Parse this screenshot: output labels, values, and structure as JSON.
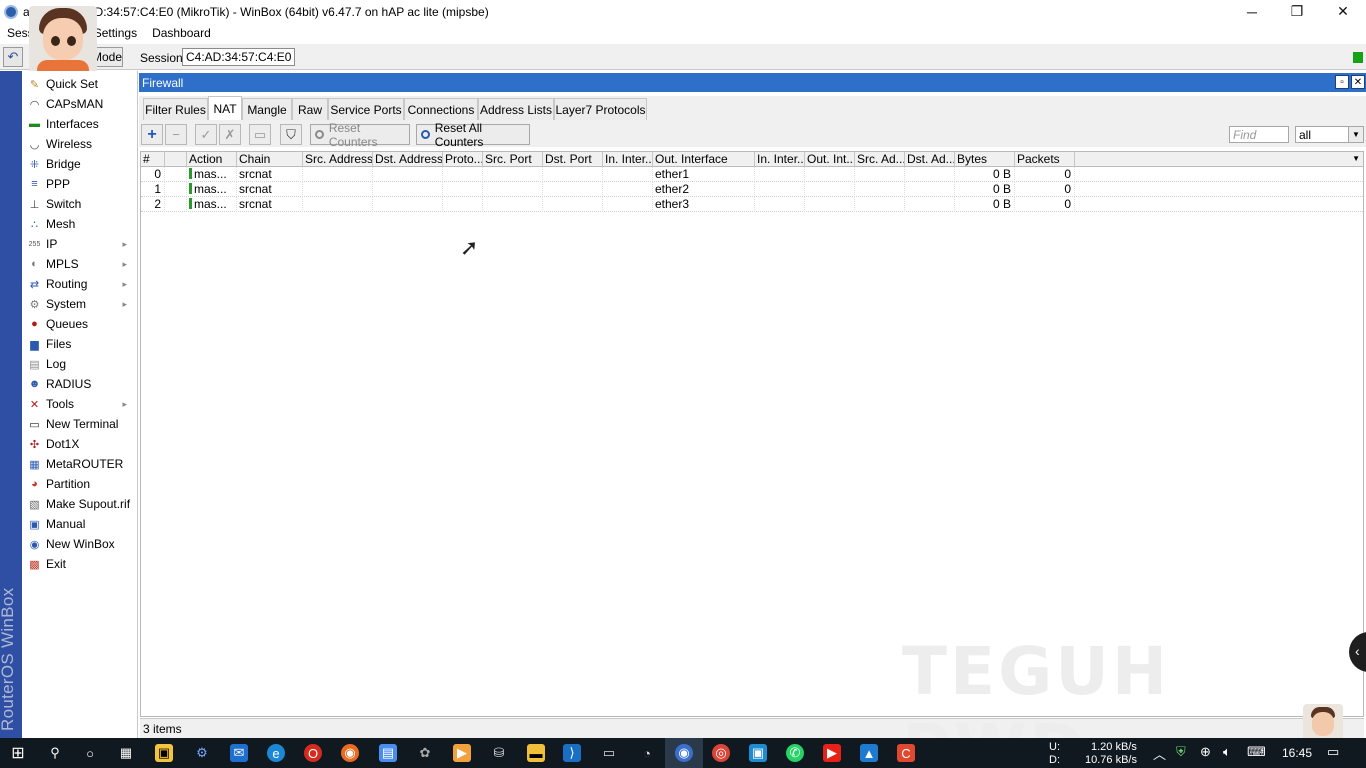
{
  "window": {
    "title": "admin@C4:AD:34:57:C4:E0 (MikroTik) - WinBox (64bit) v6.47.7 on hAP ac lite (mipsbe)",
    "minimize": "─",
    "restore": "❐",
    "close": "✕"
  },
  "menubar": {
    "items": [
      "Session",
      "Settings",
      "Dashboard"
    ]
  },
  "toolbar": {
    "undo": "↶",
    "safe_mode": "Safe Mode",
    "session_label": "Session:",
    "session_value": "C4:AD:34:57:C4:E0"
  },
  "brand": "RouterOS WinBox",
  "sidebar": {
    "items": [
      {
        "label": "Quick Set",
        "icon": "quick-set-icon",
        "glyph": "✎",
        "color": "#b58b2a",
        "submenu": false
      },
      {
        "label": "CAPsMAN",
        "icon": "capsman-icon",
        "glyph": "◠",
        "color": "#444",
        "submenu": false
      },
      {
        "label": "Interfaces",
        "icon": "interfaces-icon",
        "glyph": "▬",
        "color": "#1c8a1c",
        "submenu": false
      },
      {
        "label": "Wireless",
        "icon": "wireless-icon",
        "glyph": "◡",
        "color": "#444",
        "submenu": false
      },
      {
        "label": "Bridge",
        "icon": "bridge-icon",
        "glyph": "⁜",
        "color": "#2a59b0",
        "submenu": false
      },
      {
        "label": "PPP",
        "icon": "ppp-icon",
        "glyph": "≡",
        "color": "#2a59b0",
        "submenu": false
      },
      {
        "label": "Switch",
        "icon": "switch-icon",
        "glyph": "⊥",
        "color": "#444",
        "submenu": false
      },
      {
        "label": "Mesh",
        "icon": "mesh-icon",
        "glyph": "∴",
        "color": "#2a59b0",
        "submenu": false
      },
      {
        "label": "IP",
        "icon": "ip-icon",
        "glyph": "255",
        "color": "#555",
        "submenu": true
      },
      {
        "label": "MPLS",
        "icon": "mpls-icon",
        "glyph": "◐",
        "color": "#777",
        "submenu": true
      },
      {
        "label": "Routing",
        "icon": "routing-icon",
        "glyph": "⇄",
        "color": "#2a59b0",
        "submenu": true
      },
      {
        "label": "System",
        "icon": "system-icon",
        "glyph": "⚙",
        "color": "#777",
        "submenu": true
      },
      {
        "label": "Queues",
        "icon": "queues-icon",
        "glyph": "●",
        "color": "#b01c1c",
        "submenu": false
      },
      {
        "label": "Files",
        "icon": "files-icon",
        "glyph": "▆",
        "color": "#2a59b0",
        "submenu": false
      },
      {
        "label": "Log",
        "icon": "log-icon",
        "glyph": "▤",
        "color": "#888",
        "submenu": false
      },
      {
        "label": "RADIUS",
        "icon": "radius-icon",
        "glyph": "☻",
        "color": "#2a59b0",
        "submenu": false
      },
      {
        "label": "Tools",
        "icon": "tools-icon",
        "glyph": "✕",
        "color": "#b01c1c",
        "submenu": true
      },
      {
        "label": "New Terminal",
        "icon": "terminal-icon",
        "glyph": "▭",
        "color": "#222",
        "submenu": false
      },
      {
        "label": "Dot1X",
        "icon": "dot1x-icon",
        "glyph": "✣",
        "color": "#b01c1c",
        "submenu": false
      },
      {
        "label": "MetaROUTER",
        "icon": "metarouter-icon",
        "glyph": "▦",
        "color": "#2a59b0",
        "submenu": false
      },
      {
        "label": "Partition",
        "icon": "partition-icon",
        "glyph": "◕",
        "color": "#c0392b",
        "submenu": false
      },
      {
        "label": "Make Supout.rif",
        "icon": "supout-icon",
        "glyph": "▧",
        "color": "#666",
        "submenu": false
      },
      {
        "label": "Manual",
        "icon": "manual-icon",
        "glyph": "▣",
        "color": "#2a59b0",
        "submenu": false
      },
      {
        "label": "New WinBox",
        "icon": "winbox-icon",
        "glyph": "◉",
        "color": "#2a59b0",
        "submenu": false
      },
      {
        "label": "Exit",
        "icon": "exit-icon",
        "glyph": "▩",
        "color": "#c0392b",
        "submenu": false
      }
    ]
  },
  "firewall": {
    "title": "Firewall",
    "tabs": [
      "Filter Rules",
      "NAT",
      "Mangle",
      "Raw",
      "Service Ports",
      "Connections",
      "Address Lists",
      "Layer7 Protocols"
    ],
    "active_tab": "NAT",
    "buttons": {
      "add": "+",
      "remove": "−",
      "enable": "✓",
      "disable": "✗",
      "comment": "▭",
      "filter": "⛉",
      "reset_counters": "Reset Counters",
      "reset_all_counters": "Reset All Counters"
    },
    "find_placeholder": "Find",
    "filter_select": "all",
    "columns": [
      "#",
      "",
      "Action",
      "Chain",
      "Src. Address",
      "Dst. Address",
      "Proto...",
      "Src. Port",
      "Dst. Port",
      "In. Inter...",
      "Out. Interface",
      "In. Inter...",
      "Out. Int...",
      "Src. Ad...",
      "Dst. Ad...",
      "Bytes",
      "Packets"
    ],
    "rows": [
      {
        "num": "0",
        "action": "mas...",
        "chain": "srcnat",
        "out_interface": "ether1",
        "bytes": "0 B",
        "packets": "0"
      },
      {
        "num": "1",
        "action": "mas...",
        "chain": "srcnat",
        "out_interface": "ether2",
        "bytes": "0 B",
        "packets": "0"
      },
      {
        "num": "2",
        "action": "mas...",
        "chain": "srcnat",
        "out_interface": "ether3",
        "bytes": "0 B",
        "packets": "0"
      }
    ],
    "status": "3 items"
  },
  "watermark": "TEGUH PWD",
  "taskbar": {
    "net_up_label": "U:",
    "net_down_label": "D:",
    "net_up": "1.20 kB/s",
    "net_down": "10.76 kB/s",
    "time": "16:45"
  }
}
